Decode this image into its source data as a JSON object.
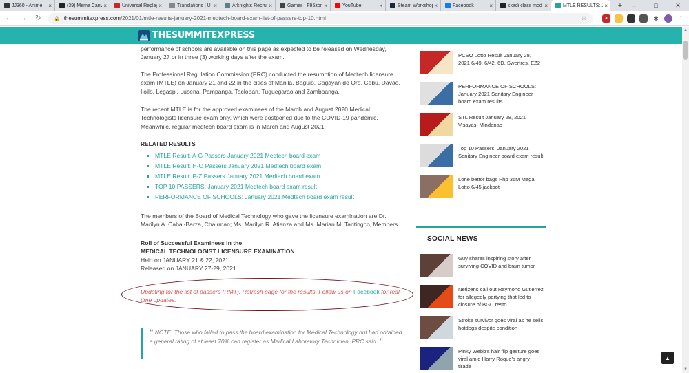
{
  "tabs": [
    {
      "label": "JJ360 - Anime",
      "fav": "#333333"
    },
    {
      "label": "(39) Meme Canv",
      "fav": "#222222"
    },
    {
      "label": "Universal Replay",
      "fav": "#c62828"
    },
    {
      "label": "Translations | U",
      "fav": "#888888"
    },
    {
      "label": "Arknights Recrui",
      "fav": "#607d8b"
    },
    {
      "label": "Games | F95zone",
      "fav": "#444444"
    },
    {
      "label": "YouTube",
      "fav": "#ff0000"
    },
    {
      "label": "Steam Workshop",
      "fav": "#1b2838"
    },
    {
      "label": "Facebook",
      "fav": "#1877f2"
    },
    {
      "label": "skadi class mod",
      "fav": "#222222"
    },
    {
      "label": "MTLE RESULTS: J",
      "fav": "#26a69a",
      "active": true
    }
  ],
  "url": {
    "domain": "thesummitexpress.com",
    "path": "/2021/01/mtle-results-january-2021-medtech-board-exam-list-of-passers-top-10.html"
  },
  "site": {
    "logo_text": "THESUMMITEXPRESS",
    "accent": "#26b3ae"
  },
  "article": {
    "p1": "performance of schools are available on this page as expected to be released on Wednesday, January 27 or in three (3) working days after the exam.",
    "p2": "The Professional Regulation Commission (PRC) conducted the resumption of Medtech licensure exam (MTLE) on January 21 and 22 in the cities of Manila, Baguio, Cagayan de Oro, Cebu, Davao, Iloilo, Legaspi, Lucena, Pampanga, Tacloban, Tuguegarao and Zamboanga.",
    "p3": "The recent MTLE is for the approved examinees of the March and August 2020 Medical Technologists licensure exam only, which were postponed due to the COVID-19 pandemic. Meanwhile, regular medtech board exam is in March and August 2021.",
    "related_heading": "RELATED RESULTS",
    "related": [
      "MTLE Result: A-G Passers January 2021 Medtech board exam",
      "MTLE Result: H-O Passers January 2021 Medtech board exam",
      "MTLE Result: P-Z Passers January 2021 Medtech board exam",
      "TOP 10 PASSERS: January 2021 Medtech board exam result",
      "PERFORMANCE OF SCHOOLS: January 2021 Medtech board exam result"
    ],
    "p4": "The members of the Board of Medical Technology who gave the licensure examination are Dr. Marilyn A. Cabal-Barza, Chairman; Ms. Marilyn R. Atienza and Ms. Marian M. Tantingco, Members.",
    "roll_line1": "Roll of Successful Examinees in the",
    "roll_line2": "MEDICAL TECHNOLOGIST LICENSURE EXAMINATION",
    "held": "Held on JANUARY 21 & 22, 2021",
    "released": "Released on JANUARY 27-29, 2021",
    "update_pre": "Updating for the list of passers (RMT). Refresh page for the results. Follow us on ",
    "update_link": "Facebook",
    "update_post": " for real-time updates.",
    "quote": "NOTE: Those who failed to pass the board examination for Medical Technology but had obtained a general rating of at least 70% can register as Medical Laboratory Technician, PRC said."
  },
  "sidebar": {
    "top_items": [
      "PCSO Lotto Result January 28, 2021 6/49, 6/42, 6D, Swertres, EZ2",
      "PERFORMANCE OF SCHOOLS: January 2021 Sanitary Engineer board exam results",
      "STL Result January 28, 2021 Visayas, Mindanao",
      "Top 10 Passers: January 2021 Sanitary Engineer board exam result",
      "Lone bettor bags Php 36M Mega Lotto 6/45 jackpot"
    ],
    "social_heading": "SOCIAL NEWS",
    "social_items": [
      "Guy shares inspiring story after surviving COVID and brain tumor",
      "Netizens call out Raymond Gutierrez for allegedly partying that led to closure of BGC resto",
      "Stroke survivor goes viral as he sells hotdogs despite condition",
      "Pinky Webb's hair flip gesture goes viral amid Harry Roque's angry tirade"
    ]
  }
}
